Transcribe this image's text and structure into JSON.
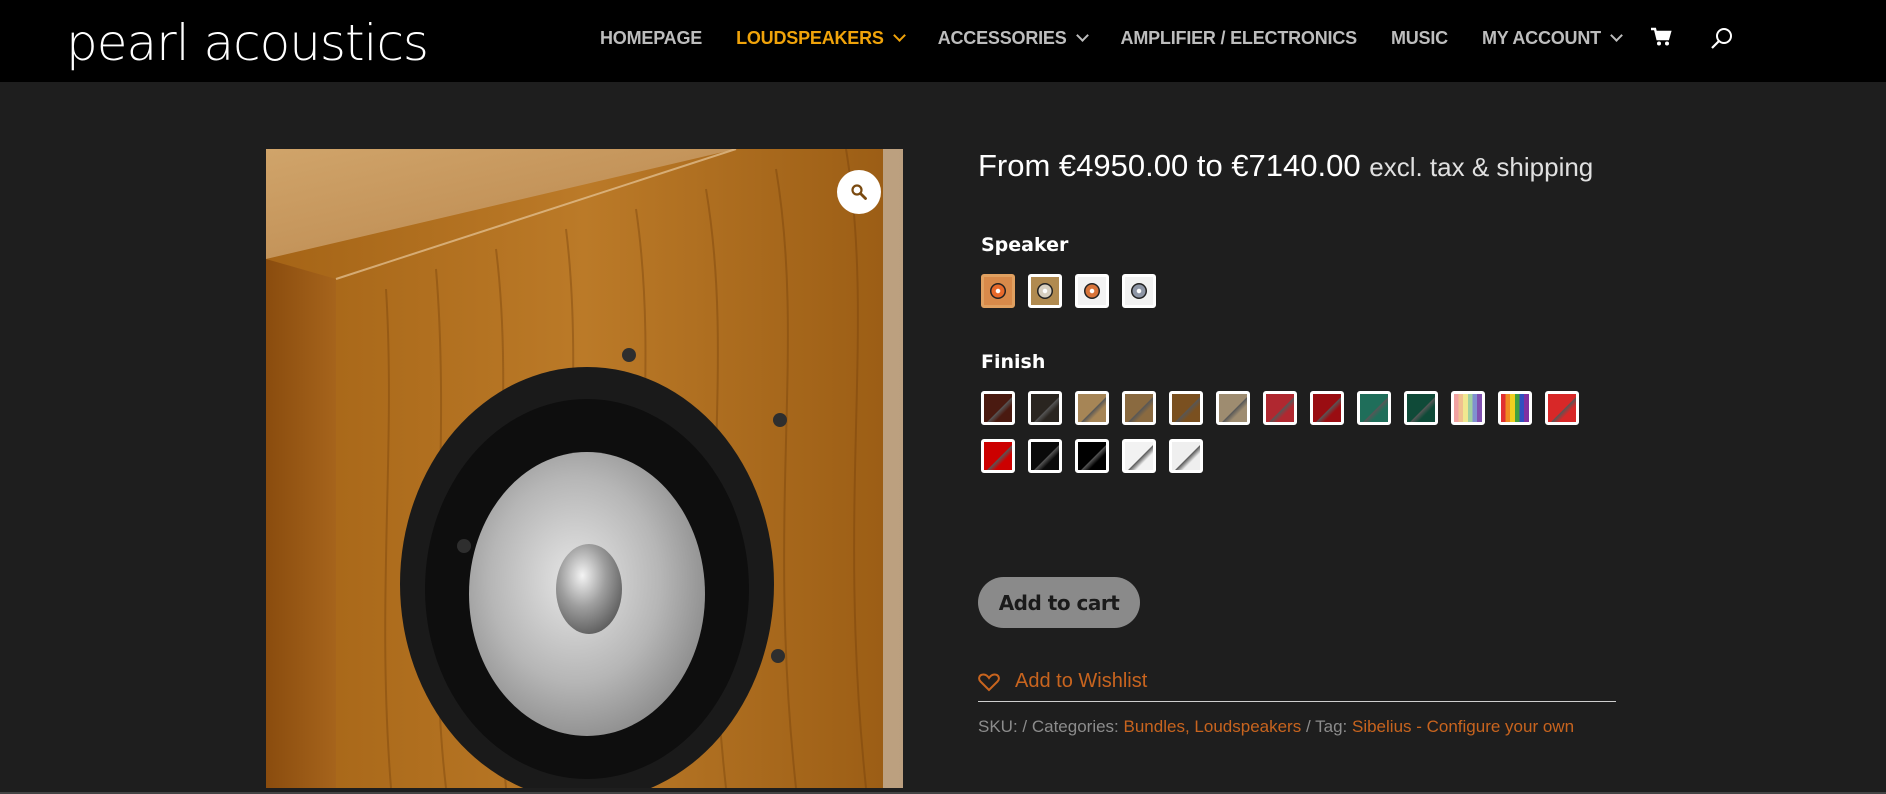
{
  "header": {
    "logo": "pearl acoustics",
    "nav": [
      {
        "label": "HOMEPAGE",
        "dropdown": false,
        "active": false
      },
      {
        "label": "LOUDSPEAKERS",
        "dropdown": true,
        "active": true
      },
      {
        "label": "ACCESSORIES",
        "dropdown": true,
        "active": false
      },
      {
        "label": "AMPLIFIER / ELECTRONICS",
        "dropdown": false,
        "active": false
      },
      {
        "label": "MUSIC",
        "dropdown": false,
        "active": false
      },
      {
        "label": "MY ACCOUNT",
        "dropdown": true,
        "active": false
      }
    ],
    "icons": {
      "cart": "cart-icon",
      "search": "search-icon"
    },
    "active_color": "#f0a30a"
  },
  "product": {
    "image_icon": "zoom-icon",
    "price": {
      "range": "From €4950.00 to €7140.00",
      "suffix": "excl. tax & shipping"
    },
    "speaker": {
      "label": "Speaker",
      "options": [
        {
          "bg": "#d88a4a",
          "cone": "#e8692a",
          "selected": true
        },
        {
          "bg": "#b08a50",
          "cone": "#d7cfc0",
          "selected": false
        },
        {
          "bg": "#f2f2f2",
          "cone": "#d8743a",
          "selected": false
        },
        {
          "bg": "#f2f2f2",
          "cone": "#8e96a6",
          "selected": false
        }
      ]
    },
    "finish": {
      "label": "Finish",
      "rows": [
        [
          "#4a1a10",
          "#2a2520",
          "#a68556",
          "#8a6a40",
          "#7a5020",
          "#9e8c70",
          "#b02830",
          "#9a0d12",
          "#1f6e5a",
          "#0f4a38",
          "rainbow-light",
          "rainbow",
          "#d82828"
        ],
        [
          "#cc0000",
          "#0a0a0a",
          "#000000",
          "#f2f2f2",
          "#efefef"
        ]
      ]
    },
    "add_to_cart": "Add to cart",
    "wishlist": {
      "label": "Add to Wishlist",
      "icon": "heart-icon"
    },
    "meta": {
      "sku": "SKU: / Categories:",
      "categories": [
        "Bundles",
        "Loudspeakers"
      ],
      "tag_label": "/ Tag:",
      "tag": "Sibelius - Configure your own"
    },
    "link_color": "#c8641e"
  }
}
